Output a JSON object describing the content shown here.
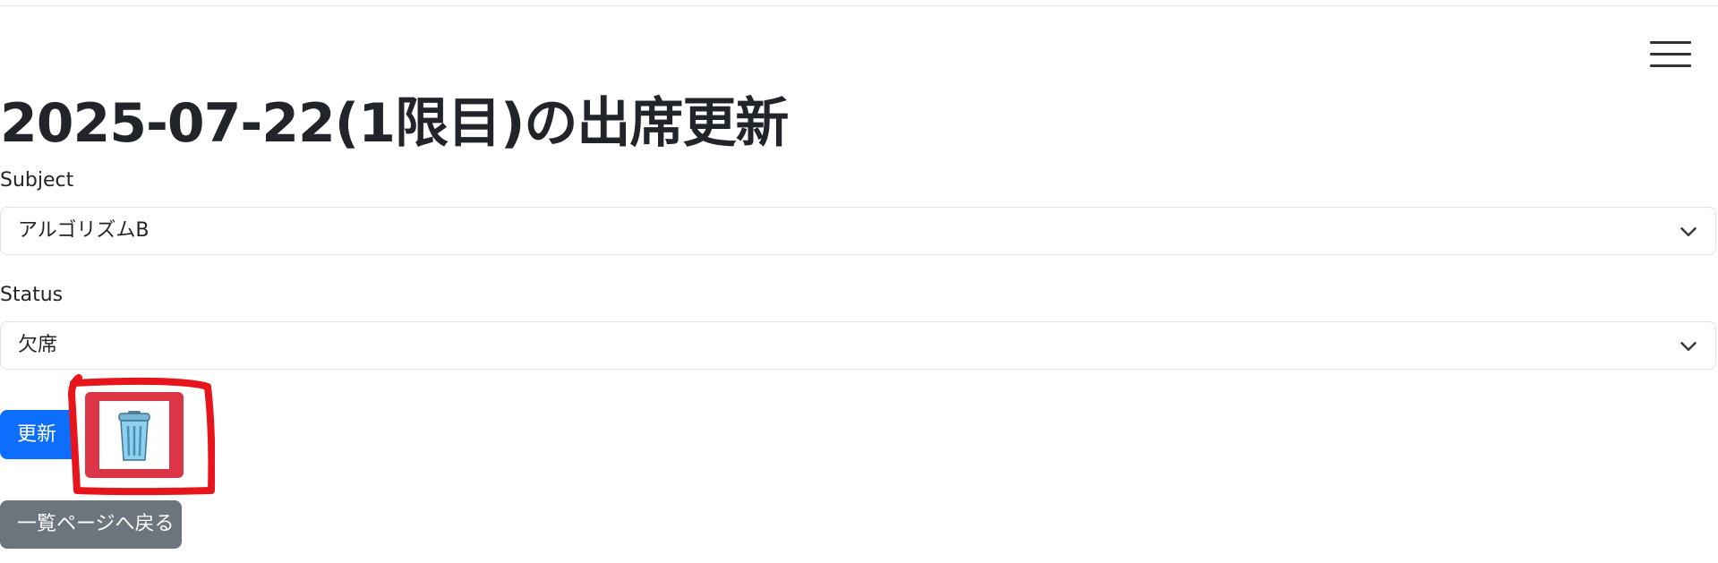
{
  "page": {
    "title": "2025-07-22(1限目)の出席更新"
  },
  "form": {
    "subject": {
      "label": "Subject",
      "selected": "アルゴリズムB"
    },
    "status": {
      "label": "Status",
      "selected": "欠席"
    }
  },
  "buttons": {
    "update_label": "更新",
    "delete_icon": "trash-can-icon",
    "back_label": "一覧ページへ戻る"
  },
  "icons": {
    "menu": "hamburger-menu-icon",
    "dropdown": "chevron-down-icon"
  },
  "colors": {
    "primary": "#0d6efd",
    "danger": "#dc3545",
    "secondary": "#6c757d",
    "annotation": "#e8141c"
  }
}
